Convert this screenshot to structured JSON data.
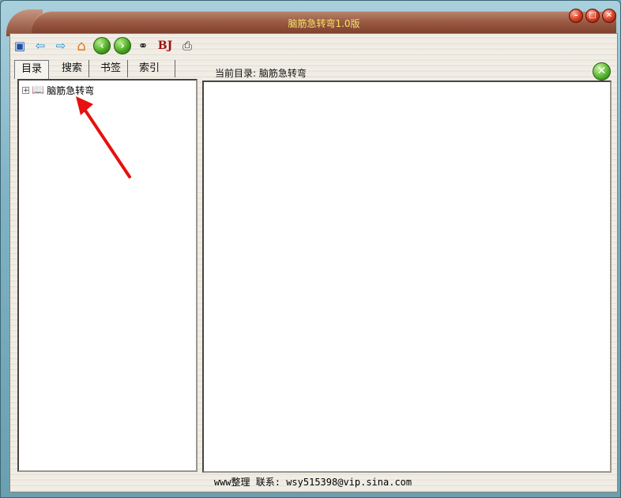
{
  "window": {
    "title": "脑筋急转弯1.0版",
    "buttons": [
      "minimize",
      "maximize",
      "close"
    ]
  },
  "toolbar": {
    "items": [
      {
        "name": "exit-icon",
        "glyph": "▣"
      },
      {
        "name": "arrow-left-icon",
        "glyph": "⇦"
      },
      {
        "name": "arrow-right-icon",
        "glyph": "⇨"
      },
      {
        "name": "home-icon",
        "glyph": "⌂"
      },
      {
        "name": "back-circle-icon",
        "glyph": "‹"
      },
      {
        "name": "forward-circle-icon",
        "glyph": "›"
      },
      {
        "name": "binoculars-icon",
        "glyph": "⚭"
      },
      {
        "name": "bj-icon",
        "glyph": "BJ"
      },
      {
        "name": "options-icon",
        "glyph": "⎙"
      }
    ]
  },
  "left_pane": {
    "tabs": [
      "目录",
      "搜索",
      "书签",
      "索引"
    ],
    "active_tab": 0,
    "tree": [
      {
        "expander": "+",
        "icon": "book-icon",
        "label": "脑筋急转弯"
      }
    ]
  },
  "right_pane": {
    "header": "当前目录: 脑筋急转弯"
  },
  "status": {
    "text": "www整理 联系: wsy515398@vip.sina.com"
  },
  "colors": {
    "title_text": "#f2e56a",
    "title_bar": "#9b5a44",
    "annotation_arrow": "#e81010"
  }
}
